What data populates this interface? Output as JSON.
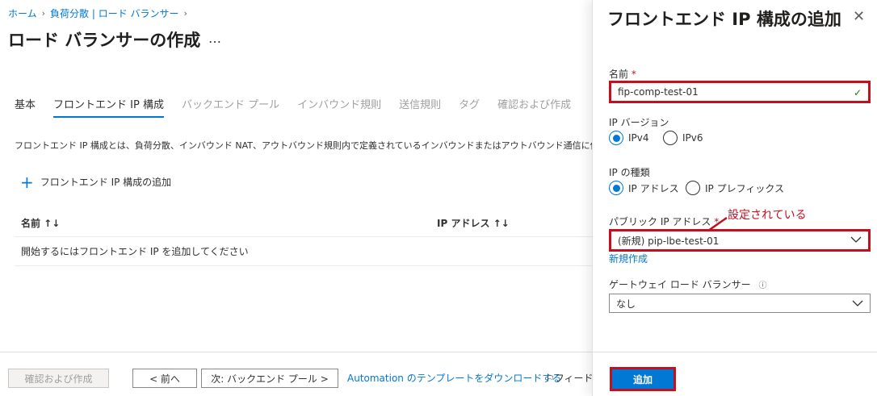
{
  "breadcrumb": {
    "home": "ホーム",
    "lb_service": "負荷分散 | ロード バランサー"
  },
  "page": {
    "title": "ロード バランサーの作成",
    "more": "…"
  },
  "tabs": [
    "基本",
    "フロントエンド IP 構成",
    "バックエンド プール",
    "インバウンド規則",
    "送信規則",
    "タグ",
    "確認および作成"
  ],
  "description": "フロントエンド IP 構成とは、負荷分散、インバウンド NAT、アウトバウンド規則内で定義されているインバウンドまたはアウトバウンド通信に使用",
  "add_frontend_label": "フロントエンド IP 構成の追加",
  "table": {
    "columns": [
      "名前 ↑↓",
      "IP アドレス ↑↓"
    ],
    "empty_message": "開始するにはフロントエンド IP を追加してください"
  },
  "footer": {
    "review_create": "確認および作成",
    "prev": "< 前へ",
    "next": "次: バックエンド プール >",
    "automation": "Automation のテンプレートをダウンロードする",
    "feedback": "フィードバック"
  },
  "panel": {
    "title": "フロントエンド IP 構成の追加",
    "name_label": "名前",
    "required_mark": "*",
    "name_value": "fip-comp-test-01",
    "ip_version_label": "IP バージョン",
    "ip_version_options": [
      "IPv4",
      "IPv6"
    ],
    "ip_type_label": "IP の種類",
    "ip_type_options": [
      "IP アドレス",
      "IP プレフィックス"
    ],
    "public_ip_label": "パブリック IP アドレス",
    "public_ip_value": "(新規) pip-lbe-test-01",
    "create_new_link": "新規作成",
    "gateway_label": "ゲートウェイ ロード バランサー",
    "gateway_value": "なし",
    "annotation": "設定されている",
    "add_button": "追加"
  },
  "colors": {
    "accent": "#0078d4",
    "highlight": "#c50f1f"
  }
}
